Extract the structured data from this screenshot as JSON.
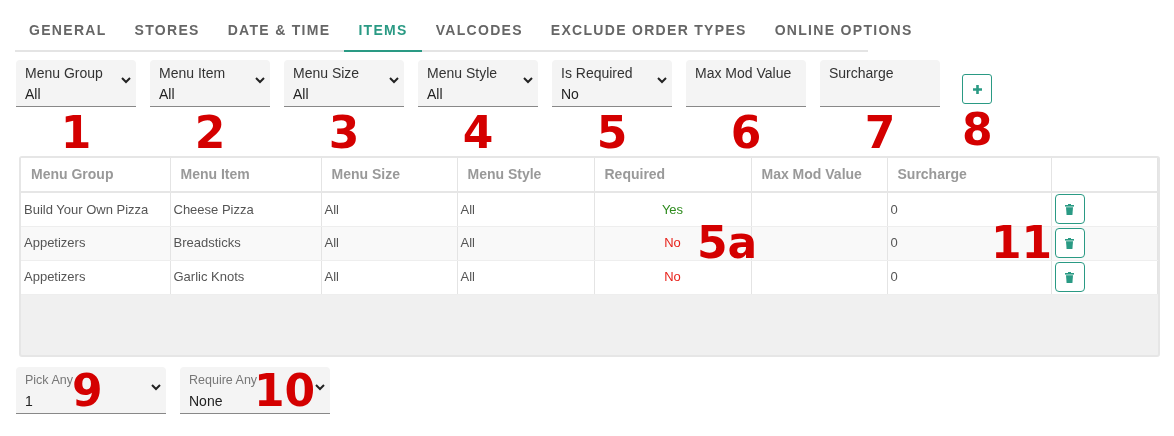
{
  "tabs": [
    {
      "label": "GENERAL",
      "selected": false
    },
    {
      "label": "STORES",
      "selected": false
    },
    {
      "label": "DATE & TIME",
      "selected": false
    },
    {
      "label": "ITEMS",
      "selected": true
    },
    {
      "label": "VALCODES",
      "selected": false
    },
    {
      "label": "EXCLUDE ORDER TYPES",
      "selected": false
    },
    {
      "label": "ONLINE OPTIONS",
      "selected": false
    }
  ],
  "filters": [
    {
      "kind": "select",
      "label": "Menu Group",
      "value": "All",
      "annotation": "1"
    },
    {
      "kind": "select",
      "label": "Menu Item",
      "value": "All",
      "annotation": "2"
    },
    {
      "kind": "select",
      "label": "Menu Size",
      "value": "All",
      "annotation": "3"
    },
    {
      "kind": "select",
      "label": "Menu Style",
      "value": "All",
      "annotation": "4"
    },
    {
      "kind": "select",
      "label": "Is Required",
      "value": "No",
      "annotation": "5"
    },
    {
      "kind": "text",
      "label": "Max Mod Value",
      "annotation": "6"
    },
    {
      "kind": "text",
      "label": "Surcharge",
      "annotation": "7"
    }
  ],
  "add_button": {
    "annotation": "8"
  },
  "table": {
    "columns": [
      "Menu Group",
      "Menu Item",
      "Menu Size",
      "Menu Style",
      "Required",
      "Max Mod Value",
      "Surcharge"
    ],
    "rows": [
      {
        "menu_group": "Build Your Own Pizza",
        "menu_item": "Cheese Pizza",
        "menu_size": "All",
        "menu_style": "All",
        "required": true,
        "required_label": "Yes",
        "surcharge": "0"
      },
      {
        "menu_group": "Appetizers",
        "menu_item": "Breadsticks",
        "menu_size": "All",
        "menu_style": "All",
        "required": false,
        "required_label": "No",
        "surcharge": "0"
      },
      {
        "menu_group": "Appetizers",
        "menu_item": "Garlic Knots",
        "menu_size": "All",
        "menu_style": "All",
        "required": false,
        "required_label": "No",
        "surcharge": "0"
      }
    ],
    "annotations": [
      "5a",
      "11"
    ]
  },
  "bottom_selects": [
    {
      "label": "Pick Any",
      "value": "1",
      "annotation": "9"
    },
    {
      "label": "Require Any",
      "value": "None",
      "annotation": "10"
    }
  ]
}
